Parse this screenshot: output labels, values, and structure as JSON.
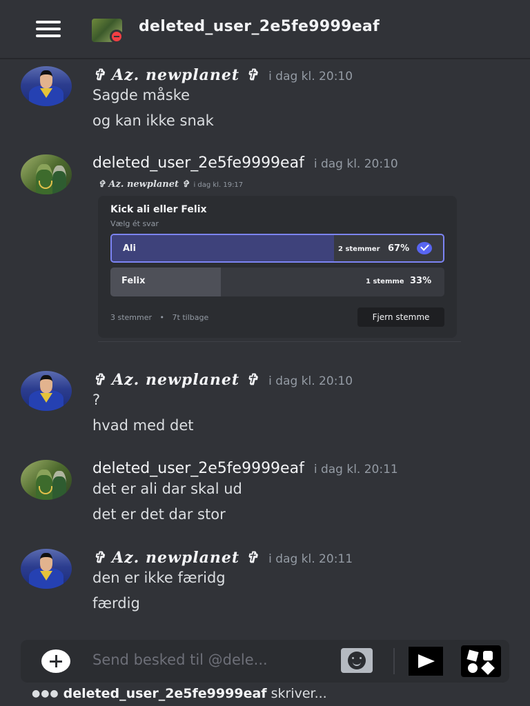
{
  "header": {
    "title": "deleted_user_2e5fe9999eaf"
  },
  "messages": [
    {
      "author": "✞ 𝑨𝒛. 𝒏𝒆𝒘𝒑𝒍𝒂𝒏𝒆𝒕 ✞",
      "time": "i dag kl. 20:10",
      "lines": [
        "Sagde måske",
        "og kan ikke snak"
      ]
    },
    {
      "author": "deleted_user_2e5fe9999eaf",
      "time": "i dag kl. 20:10",
      "reply": {
        "author": "✞ 𝑨𝒛. 𝒏𝒆𝒘𝒑𝒍𝒂𝒏𝒆𝒕 ✞",
        "time": "i dag kl. 19:17"
      },
      "poll": {
        "question": "Kick ali eller Felix",
        "subtitle": "Vælg ét svar",
        "options": [
          {
            "label": "Ali",
            "votes": "2 stemmer",
            "percent": "67%",
            "fraction": 0.67,
            "selected": true
          },
          {
            "label": "Felix",
            "votes": "1 stemme",
            "percent": "33%",
            "fraction": 0.33,
            "selected": false
          }
        ],
        "total_votes": "3 stemmer",
        "separator": "•",
        "time_left": "7t tilbage",
        "remove_vote_label": "Fjern stemme"
      }
    },
    {
      "author": "✞ 𝑨𝒛. 𝒏𝒆𝒘𝒑𝒍𝒂𝒏𝒆𝒕 ✞",
      "time": "i dag kl. 20:10",
      "lines": [
        "?",
        "hvad med det"
      ]
    },
    {
      "author": "deleted_user_2e5fe9999eaf",
      "time": "i dag kl. 20:11",
      "lines": [
        "det er ali dar skal ud",
        "det er det dar stor"
      ]
    },
    {
      "author": "✞ 𝑨𝒛. 𝒏𝒆𝒘𝒑𝒍𝒂𝒏𝒆𝒕 ✞",
      "time": "i dag kl. 20:11",
      "lines": [
        "den er ikke færidg",
        "færdig"
      ]
    }
  ],
  "composer": {
    "placeholder": "Send besked til @dele..."
  },
  "typing": {
    "dots": "●●●",
    "user": "deleted_user_2e5fe9999eaf",
    "suffix": "skriver..."
  },
  "colors": {
    "background": "#313338",
    "accent": "#5865f2",
    "selected_fill": "#3e427b"
  },
  "icons": {
    "menu": "hamburger-icon",
    "status": "dnd-status-icon",
    "add": "plus-circle-icon",
    "emoji": "smiley-icon",
    "send": "send-arrow-icon",
    "apps": "apps-icon",
    "check": "checkmark-icon"
  }
}
